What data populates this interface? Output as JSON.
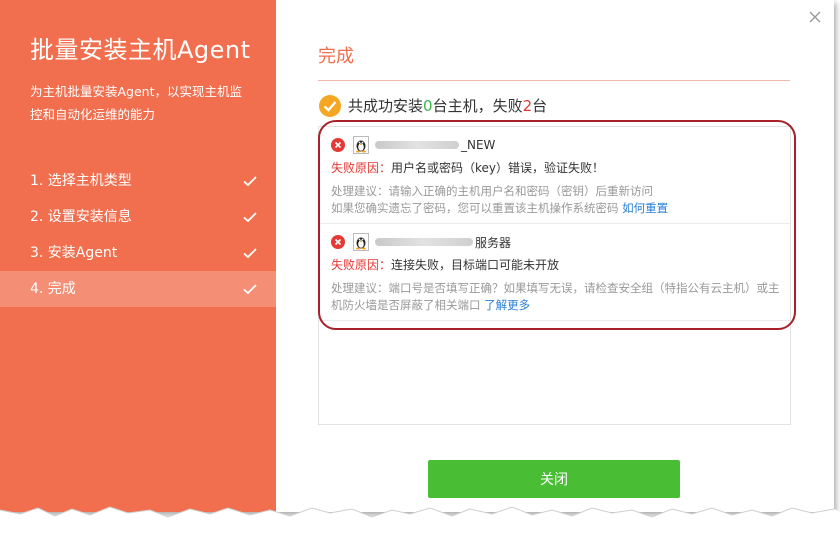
{
  "sidebar": {
    "title": "批量安装主机Agent",
    "description": "为主机批量安装Agent，以实现主机监控和自动化运维的能力",
    "steps": [
      {
        "label": "1. 选择主机类型",
        "done": true
      },
      {
        "label": "2. 设置安装信息",
        "done": true
      },
      {
        "label": "3. 安装Agent",
        "done": true
      },
      {
        "label": "4. 完成",
        "done": true,
        "active": true
      }
    ]
  },
  "main": {
    "title": "完成",
    "summary": {
      "prefix": "共成功安装",
      "success_count": "0",
      "middle": "台主机，失败",
      "fail_count": "2",
      "suffix": "台"
    },
    "results": [
      {
        "host_suffix": "_NEW",
        "reason_label": "失败原因：",
        "reason": "用户名或密码（key）错误，验证失败！",
        "suggestion": "处理建议：请输入正确的主机用户名和密码（密钥）后重新访问\n如果您确实遗忘了密码，您可以重置该主机操作系统密码",
        "link": "如何重置"
      },
      {
        "host_suffix": "服务器",
        "reason_label": "失败原因：",
        "reason": "连接失败，目标端口可能未开放",
        "suggestion": "处理建议：端口号是否填写正确？如果填写无误，请检查安全组（特指公有云主机）或主机防火墙是否屏蔽了相关端口",
        "link": "了解更多"
      }
    ],
    "close_label": "关闭"
  },
  "colors": {
    "accent": "#f16f4e",
    "success": "#39b54a",
    "fail": "#e53935",
    "button": "#49bd34",
    "link": "#2a7fd4"
  }
}
